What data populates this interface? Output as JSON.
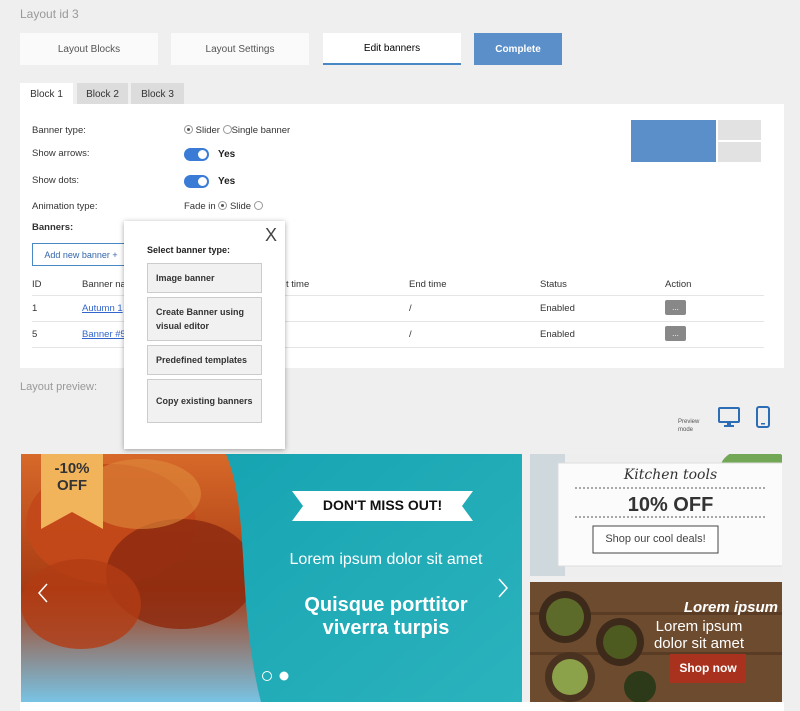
{
  "page": {
    "layout_id": "Layout id 3"
  },
  "steps": [
    {
      "label": "Layout Blocks",
      "state": "normal"
    },
    {
      "label": "Layout Settings",
      "state": "normal"
    },
    {
      "label": "Edit banners",
      "state": "active"
    },
    {
      "label": "Complete",
      "state": "complete"
    }
  ],
  "block_tabs": [
    "Block 1",
    "Block 2",
    "Block 3"
  ],
  "form": {
    "banner_type_label": "Banner type:",
    "banner_type_opt1": "Slider",
    "banner_type_opt2": "Single banner",
    "show_arrows_label": "Show arrows:",
    "show_arrows_value": "Yes",
    "show_dots_label": "Show dots:",
    "show_dots_value": "Yes",
    "animation_label": "Animation type:",
    "animation_opt1": "Fade in",
    "animation_opt2": "Slide",
    "banners_label": "Banners:",
    "add_banner": "Add new banner +"
  },
  "table": {
    "headers": {
      "id": "ID",
      "name": "Banner na",
      "start": "t time",
      "end": "End time",
      "status": "Status",
      "action": "Action"
    },
    "rows": [
      {
        "id": "1",
        "name": "Autumn 1",
        "end": "/",
        "status": "Enabled",
        "action": "..."
      },
      {
        "id": "5",
        "name": "Banner #5",
        "end": "/",
        "status": "Enabled",
        "action": "..."
      }
    ]
  },
  "popup": {
    "title": "Select banner type:",
    "close": "X",
    "options": [
      "Image banner",
      "Create Banner using visual editor",
      "Predefined templates",
      "Copy existing banners"
    ]
  },
  "preview": {
    "label": "Layout preview:",
    "mode_label_1": "Preview",
    "mode_label_2": "mode",
    "desktop_icon": "desktop-icon",
    "mobile_icon": "mobile-icon"
  },
  "banner_main": {
    "ribbon_1": "-10%",
    "ribbon_2": "OFF",
    "headline": "DON'T MISS OUT!",
    "sub": "Lorem ipsum dolor sit amet",
    "big_1": "Quisque porttitor",
    "big_2": "viverra turpis"
  },
  "banner_side1": {
    "title": "Kitchen tools",
    "offer": "10% OFF",
    "cta": "Shop our cool deals!"
  },
  "banner_side2": {
    "title": "Lorem ipsum",
    "line1": "Lorem ipsum",
    "line2": "dolor sit amet",
    "cta": "Shop now"
  },
  "colors": {
    "accent": "#4a87c5",
    "complete": "#5b8fc9",
    "toggle": "#3a7bd5",
    "teal": "#20a9b5",
    "ribbon": "#f2b45a",
    "cta_red": "#a8321e"
  }
}
